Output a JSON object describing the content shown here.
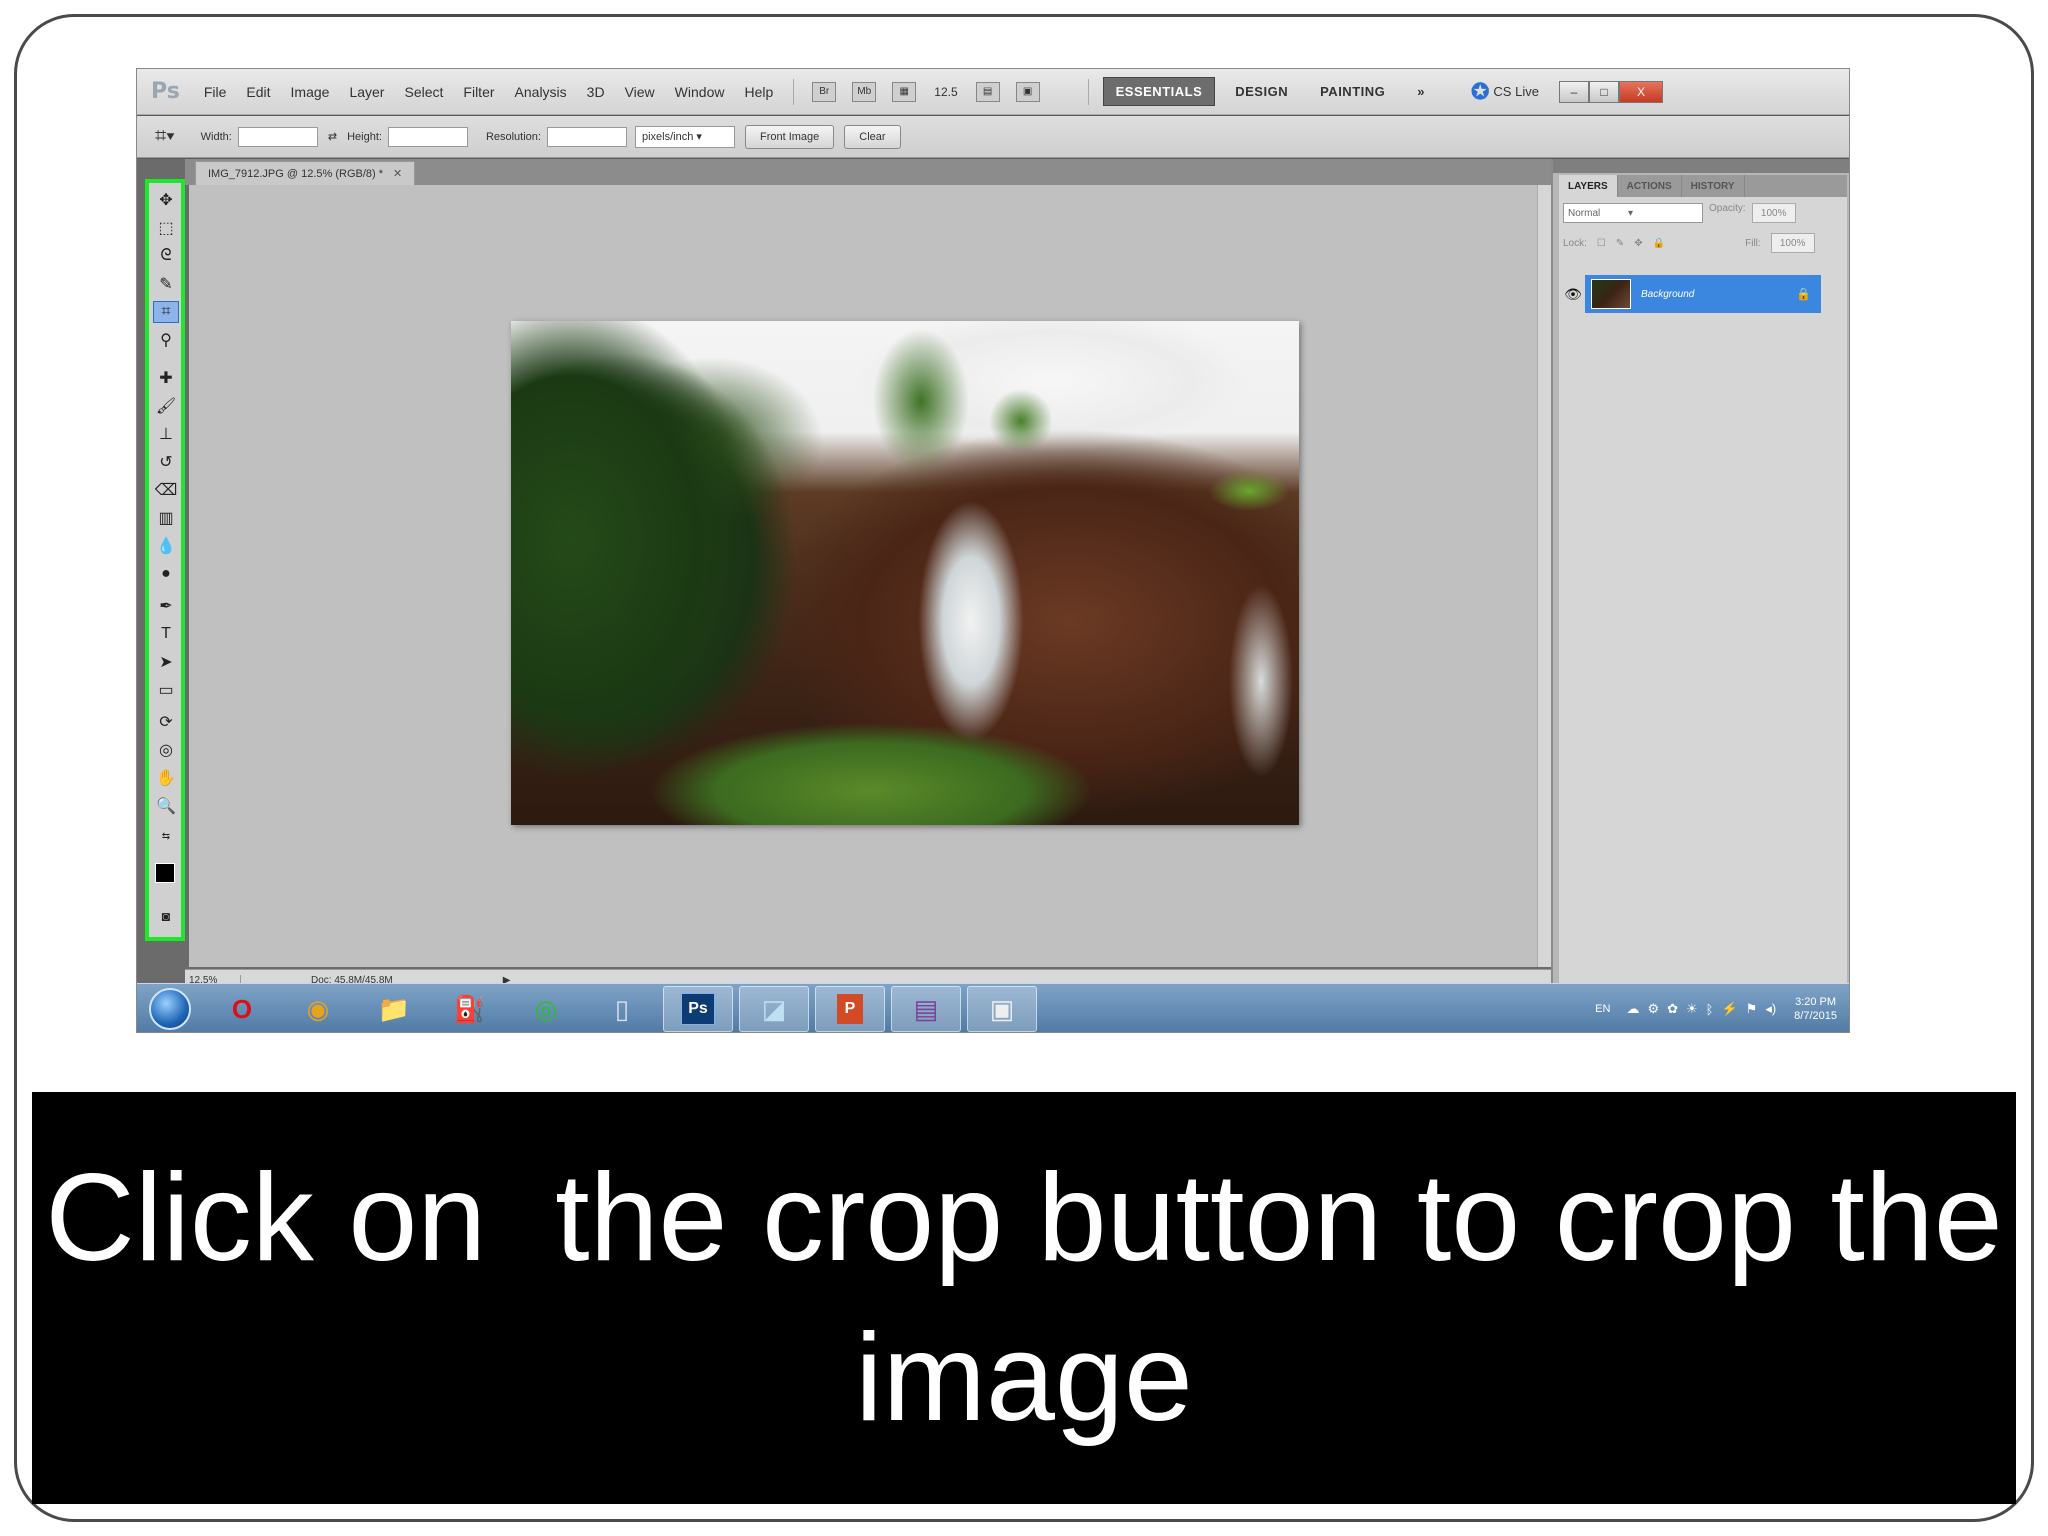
{
  "caption": "Click on  the crop button to crop the image",
  "photoshop": {
    "logo": "Ps",
    "menu": [
      "File",
      "Edit",
      "Image",
      "Layer",
      "Select",
      "Filter",
      "Analysis",
      "3D",
      "View",
      "Window",
      "Help"
    ],
    "menubar_buttons": [
      "Br",
      "Mb"
    ],
    "zoom_dropdown": "12.5",
    "workspaces": [
      "ESSENTIALS",
      "DESIGN",
      "PAINTING"
    ],
    "workspace_more": "»",
    "cslive": "CS Live",
    "window_controls": [
      "–",
      "□",
      "X"
    ],
    "options": {
      "width_label": "Width:",
      "height_label": "Height:",
      "resolution_label": "Resolution:",
      "units": "pixels/inch",
      "front_image": "Front Image",
      "clear": "Clear"
    },
    "document_tab": "IMG_7912.JPG @ 12.5% (RGB/8) *",
    "status": {
      "zoom": "12.5%",
      "doc": "Doc: 45.8M/45.8M"
    },
    "panels": {
      "tabs": [
        "LAYERS",
        "ACTIONS",
        "HISTORY"
      ],
      "blend_mode": "Normal",
      "opacity_label": "Opacity:",
      "opacity_value": "100%",
      "lock_label": "Lock:",
      "fill_label": "Fill:",
      "fill_value": "100%",
      "layer_name": "Background"
    },
    "tools": [
      "move",
      "marquee",
      "lasso",
      "quick-select",
      "crop",
      "eyedropper",
      "healing",
      "brush",
      "clone-stamp",
      "history-brush",
      "eraser",
      "gradient",
      "blur",
      "dodge",
      "pen",
      "type",
      "path-select",
      "shape",
      "3d-rotate",
      "3d-orbit",
      "hand",
      "zoom"
    ],
    "selected_tool": "crop"
  },
  "taskbar": {
    "apps": [
      "Opera",
      "Chrome",
      "Explorer",
      "Network",
      "Media",
      "USB",
      "Photoshop",
      "Ruler",
      "PowerPoint",
      "WinRAR",
      "Recorder"
    ],
    "language": "EN",
    "time": "3:20 PM",
    "date": "8/7/2015"
  },
  "colors": {
    "highlight": "#1ee82a",
    "caption_bg": "#000000",
    "caption_text": "#ffffff",
    "layer_selected": "#3b87e0"
  }
}
